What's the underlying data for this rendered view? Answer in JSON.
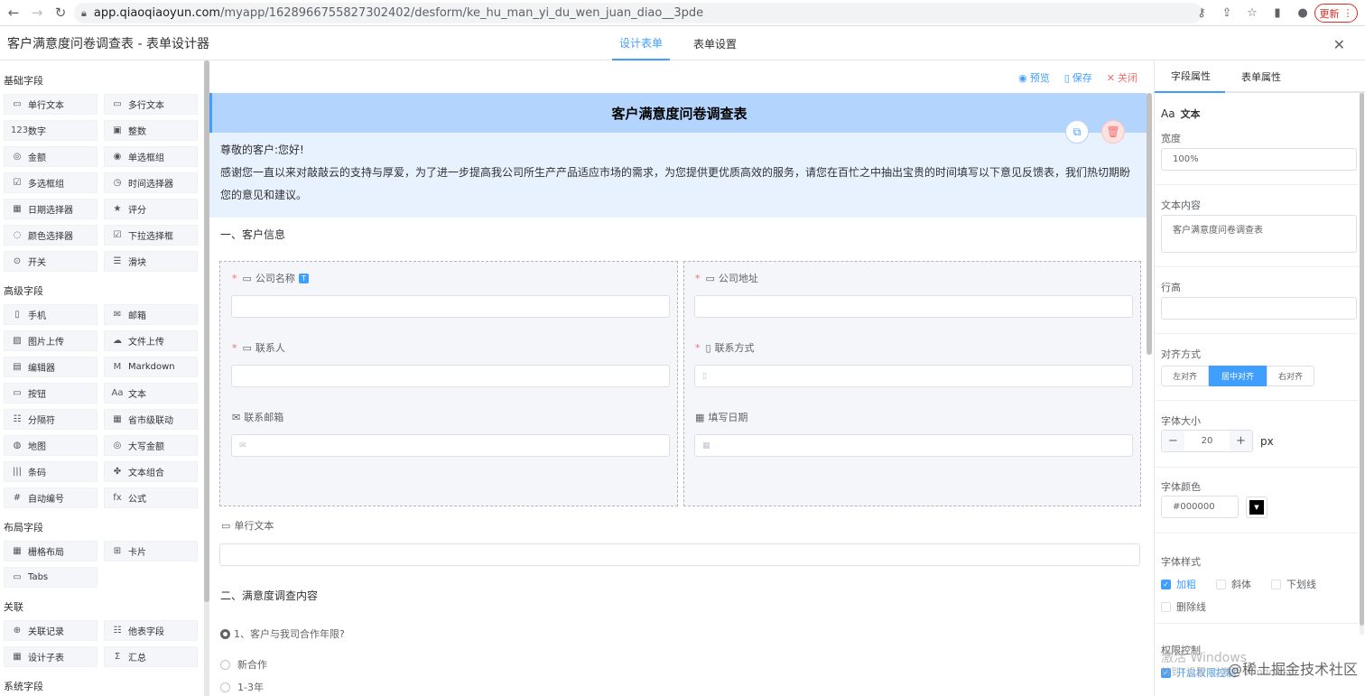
{
  "browser": {
    "url_host": "app.qiaoqiaoyun.com",
    "url_path": "/myapp/1628966755827302402/desform/ke_hu_man_yi_du_wen_juan_diao__3pde",
    "update_label": "更新"
  },
  "app": {
    "title": "客户满意度问卷调查表 - 表单设计器",
    "tabs": [
      "设计表单",
      "表单设置"
    ]
  },
  "palette": {
    "basic_title": "基础字段",
    "basic": [
      {
        "icon": "▭",
        "label": "单行文本"
      },
      {
        "icon": "▭",
        "label": "多行文本"
      },
      {
        "icon": "123",
        "label": "数字"
      },
      {
        "icon": "▣",
        "label": "整数"
      },
      {
        "icon": "◎",
        "label": "金额"
      },
      {
        "icon": "◉",
        "label": "单选框组"
      },
      {
        "icon": "☑",
        "label": "多选框组"
      },
      {
        "icon": "◷",
        "label": "时间选择器"
      },
      {
        "icon": "▦",
        "label": "日期选择器"
      },
      {
        "icon": "★",
        "label": "评分"
      },
      {
        "icon": "◌",
        "label": "颜色选择器"
      },
      {
        "icon": "☑",
        "label": "下拉选择框"
      },
      {
        "icon": "⊙",
        "label": "开关"
      },
      {
        "icon": "☰",
        "label": "滑块"
      }
    ],
    "advanced_title": "高级字段",
    "advanced": [
      {
        "icon": "▯",
        "label": "手机"
      },
      {
        "icon": "✉",
        "label": "邮箱"
      },
      {
        "icon": "▨",
        "label": "图片上传"
      },
      {
        "icon": "☁",
        "label": "文件上传"
      },
      {
        "icon": "▤",
        "label": "编辑器"
      },
      {
        "icon": "M",
        "label": "Markdown"
      },
      {
        "icon": "▭",
        "label": "按钮"
      },
      {
        "icon": "Aa",
        "label": "文本"
      },
      {
        "icon": "☷",
        "label": "分隔符"
      },
      {
        "icon": "▦",
        "label": "省市级联动"
      },
      {
        "icon": "◍",
        "label": "地图"
      },
      {
        "icon": "◎",
        "label": "大写金额"
      },
      {
        "icon": "|||",
        "label": "条码"
      },
      {
        "icon": "✤",
        "label": "文本组合"
      },
      {
        "icon": "#",
        "label": "自动编号"
      },
      {
        "icon": "fx",
        "label": "公式"
      }
    ],
    "layout_title": "布局字段",
    "layout": [
      {
        "icon": "▦",
        "label": "栅格布局"
      },
      {
        "icon": "⊞",
        "label": "卡片"
      },
      {
        "icon": "▭",
        "label": "Tabs"
      }
    ],
    "relation_title": "关联",
    "relation": [
      {
        "icon": "⊕",
        "label": "关联记录"
      },
      {
        "icon": "☷",
        "label": "他表字段"
      },
      {
        "icon": "▦",
        "label": "设计子表"
      },
      {
        "icon": "Σ",
        "label": "汇总"
      }
    ],
    "system_title": "系统字段"
  },
  "toolbar": {
    "preview": "预览",
    "save": "保存",
    "close": "关闭"
  },
  "form": {
    "title": "客户满意度问卷调查表",
    "greeting": "尊敬的客户:您好!",
    "intro": "感谢您一直以来对敲敲云的支持与厚爱，为了进一步提高我公司所生产产品适应市场的需求，为您提供更优质高效的服务，请您在百忙之中抽出宝贵的时间填写以下意见反馈表，我们热切期盼您的意见和建议。",
    "section1": "一、客户信息",
    "company_name": "公司名称",
    "company_addr": "公司地址",
    "contact": "联系人",
    "contact_way": "联系方式",
    "email": "联系邮箱",
    "fill_date": "填写日期",
    "single_text": "单行文本",
    "section2": "二、满意度调查内容",
    "q1": "1、客户与我司合作年限?",
    "q1_options": [
      "新合作",
      "1-3年"
    ]
  },
  "props": {
    "tabs": [
      "字段属性",
      "表单属性"
    ],
    "type_label": "文本",
    "width_label": "宽度",
    "width_value": "100%",
    "content_label": "文本内容",
    "content_value": "客户满意度问卷调查表",
    "line_height_label": "行高",
    "align_label": "对齐方式",
    "align_options": [
      "左对齐",
      "居中对齐",
      "右对齐"
    ],
    "font_size_label": "字体大小",
    "font_size_value": "20",
    "font_size_unit": "px",
    "font_color_label": "字体颜色",
    "font_color_value": "#000000",
    "font_style_label": "字体样式",
    "bold": "加粗",
    "italic": "斜体",
    "underline": "下划线",
    "strike": "删除线",
    "permission_label": "权限控制",
    "permission_opt": "开启权限控制"
  },
  "watermark": {
    "line1": "激活 Windows",
    "line2": "转到“设置”以激活 Windows。",
    "brand": "@稀土掘金技术社区"
  }
}
